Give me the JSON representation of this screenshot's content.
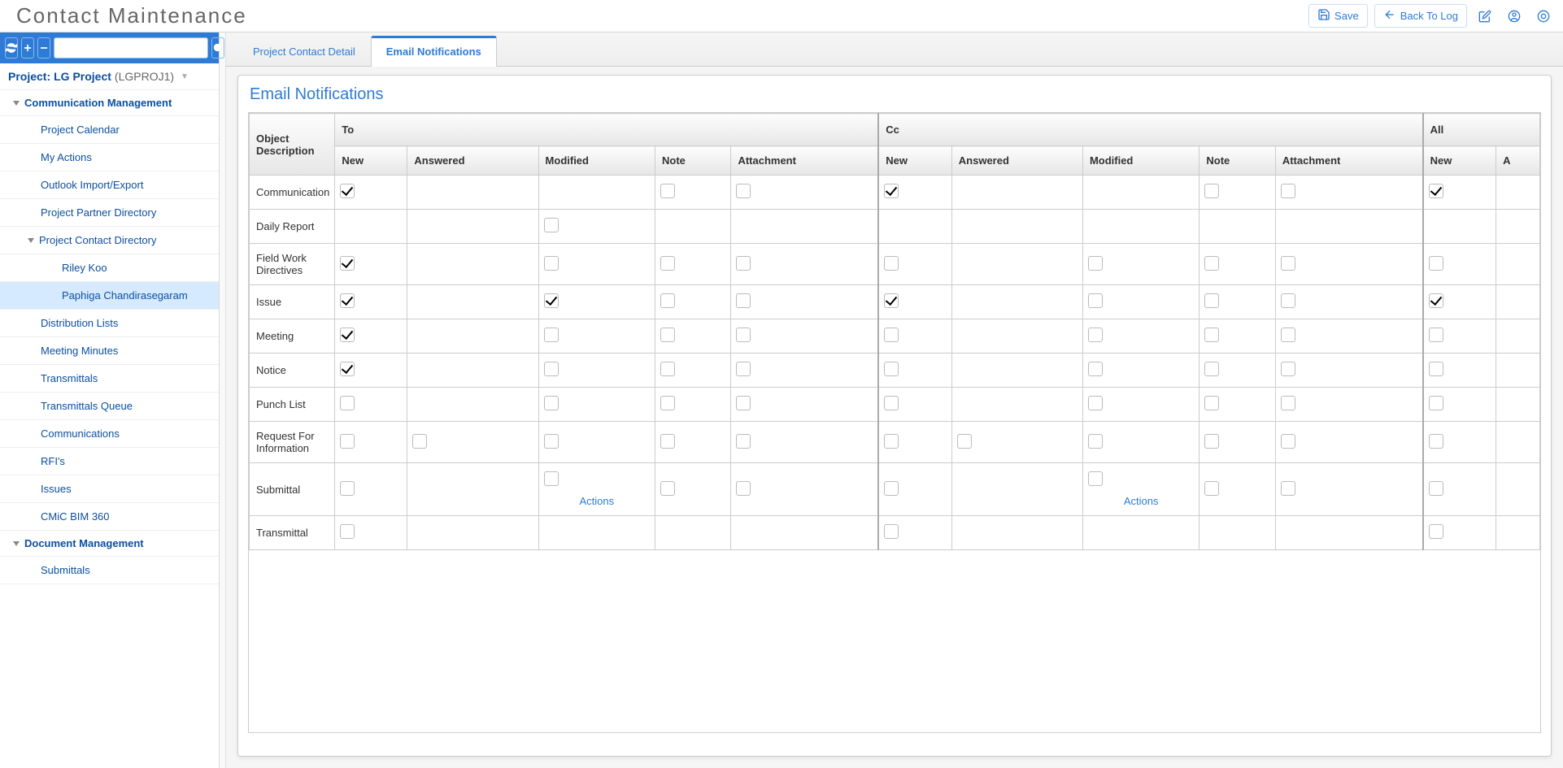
{
  "header": {
    "title": "Contact Maintenance",
    "save_label": "Save",
    "back_label": "Back To Log"
  },
  "sidebar": {
    "search_placeholder": "",
    "project_prefix": "Project:",
    "project_name": "LG Project",
    "project_code": "(LGPROJ1)",
    "groups": [
      {
        "label": "Communication Management",
        "items": [
          {
            "label": "Project Calendar"
          },
          {
            "label": "My Actions"
          },
          {
            "label": "Outlook Import/Export"
          },
          {
            "label": "Project Partner Directory"
          },
          {
            "label": "Project Contact Directory",
            "has_children": true,
            "children": [
              {
                "label": "Riley Koo"
              },
              {
                "label": "Paphiga Chandirasegaram",
                "selected": true
              }
            ]
          },
          {
            "label": "Distribution Lists"
          },
          {
            "label": "Meeting Minutes"
          },
          {
            "label": "Transmittals"
          },
          {
            "label": "Transmittals Queue"
          },
          {
            "label": "Communications"
          },
          {
            "label": "RFI's"
          },
          {
            "label": "Issues"
          },
          {
            "label": "CMiC BIM 360"
          }
        ]
      },
      {
        "label": "Document Management",
        "items": [
          {
            "label": "Submittals"
          }
        ]
      }
    ]
  },
  "tabs": [
    {
      "label": "Project Contact Detail",
      "active": false
    },
    {
      "label": "Email Notifications",
      "active": true
    }
  ],
  "panel": {
    "title": "Email Notifications",
    "actions_label": "Actions",
    "row_header": "Object Description",
    "col_groups": [
      "To",
      "Cc",
      "All"
    ],
    "sub_cols": [
      "New",
      "Answered",
      "Modified",
      "Note",
      "Attachment"
    ],
    "all_sub_cols_visible": [
      "New",
      "Answered"
    ],
    "chart_data": {
      "type": "table",
      "columns": [
        "Object Description",
        "To.New",
        "To.Answered",
        "To.Modified",
        "To.Note",
        "To.Attachment",
        "Cc.New",
        "Cc.Answered",
        "Cc.Modified",
        "Cc.Note",
        "Cc.Attachment",
        "All.New"
      ],
      "rows": [
        {
          "label": "Communication",
          "cells": [
            {
              "present": true,
              "checked": true
            },
            {
              "present": false
            },
            {
              "present": false
            },
            {
              "present": true,
              "checked": false
            },
            {
              "present": true,
              "checked": false
            },
            {
              "present": true,
              "checked": true
            },
            {
              "present": false
            },
            {
              "present": false
            },
            {
              "present": true,
              "checked": false
            },
            {
              "present": true,
              "checked": false
            },
            {
              "present": true,
              "checked": true
            }
          ]
        },
        {
          "label": "Daily Report",
          "cells": [
            {
              "present": false
            },
            {
              "present": false
            },
            {
              "present": true,
              "checked": false
            },
            {
              "present": false
            },
            {
              "present": false
            },
            {
              "present": false
            },
            {
              "present": false
            },
            {
              "present": false
            },
            {
              "present": false
            },
            {
              "present": false
            },
            {
              "present": false
            }
          ]
        },
        {
          "label": "Field Work Directives",
          "cells": [
            {
              "present": true,
              "checked": true
            },
            {
              "present": false
            },
            {
              "present": true,
              "checked": false
            },
            {
              "present": true,
              "checked": false
            },
            {
              "present": true,
              "checked": false
            },
            {
              "present": true,
              "checked": false
            },
            {
              "present": false
            },
            {
              "present": true,
              "checked": false
            },
            {
              "present": true,
              "checked": false
            },
            {
              "present": true,
              "checked": false
            },
            {
              "present": true,
              "checked": false
            }
          ]
        },
        {
          "label": "Issue",
          "cells": [
            {
              "present": true,
              "checked": true
            },
            {
              "present": false
            },
            {
              "present": true,
              "checked": true
            },
            {
              "present": true,
              "checked": false
            },
            {
              "present": true,
              "checked": false
            },
            {
              "present": true,
              "checked": true
            },
            {
              "present": false
            },
            {
              "present": true,
              "checked": false
            },
            {
              "present": true,
              "checked": false
            },
            {
              "present": true,
              "checked": false
            },
            {
              "present": true,
              "checked": true
            }
          ]
        },
        {
          "label": "Meeting",
          "cells": [
            {
              "present": true,
              "checked": true
            },
            {
              "present": false
            },
            {
              "present": true,
              "checked": false
            },
            {
              "present": true,
              "checked": false
            },
            {
              "present": true,
              "checked": false
            },
            {
              "present": true,
              "checked": false
            },
            {
              "present": false
            },
            {
              "present": true,
              "checked": false
            },
            {
              "present": true,
              "checked": false
            },
            {
              "present": true,
              "checked": false
            },
            {
              "present": true,
              "checked": false
            }
          ]
        },
        {
          "label": "Notice",
          "cells": [
            {
              "present": true,
              "checked": true
            },
            {
              "present": false
            },
            {
              "present": true,
              "checked": false
            },
            {
              "present": true,
              "checked": false
            },
            {
              "present": true,
              "checked": false
            },
            {
              "present": true,
              "checked": false
            },
            {
              "present": false
            },
            {
              "present": true,
              "checked": false
            },
            {
              "present": true,
              "checked": false
            },
            {
              "present": true,
              "checked": false
            },
            {
              "present": true,
              "checked": false
            }
          ]
        },
        {
          "label": "Punch List",
          "cells": [
            {
              "present": true,
              "checked": false
            },
            {
              "present": false
            },
            {
              "present": true,
              "checked": false
            },
            {
              "present": true,
              "checked": false
            },
            {
              "present": true,
              "checked": false
            },
            {
              "present": true,
              "checked": false
            },
            {
              "present": false
            },
            {
              "present": true,
              "checked": false
            },
            {
              "present": true,
              "checked": false
            },
            {
              "present": true,
              "checked": false
            },
            {
              "present": true,
              "checked": false
            }
          ]
        },
        {
          "label": "Request For Information",
          "cells": [
            {
              "present": true,
              "checked": false
            },
            {
              "present": true,
              "checked": false
            },
            {
              "present": true,
              "checked": false
            },
            {
              "present": true,
              "checked": false
            },
            {
              "present": true,
              "checked": false
            },
            {
              "present": true,
              "checked": false
            },
            {
              "present": true,
              "checked": false
            },
            {
              "present": true,
              "checked": false
            },
            {
              "present": true,
              "checked": false
            },
            {
              "present": true,
              "checked": false
            },
            {
              "present": true,
              "checked": false
            }
          ]
        },
        {
          "label": "Submittal",
          "actions": true,
          "cells": [
            {
              "present": true,
              "checked": false
            },
            {
              "present": false
            },
            {
              "present": true,
              "checked": false,
              "actions": true
            },
            {
              "present": true,
              "checked": false
            },
            {
              "present": true,
              "checked": false
            },
            {
              "present": true,
              "checked": false
            },
            {
              "present": false
            },
            {
              "present": true,
              "checked": false,
              "actions": true
            },
            {
              "present": true,
              "checked": false
            },
            {
              "present": true,
              "checked": false
            },
            {
              "present": true,
              "checked": false
            }
          ]
        },
        {
          "label": "Transmittal",
          "cells": [
            {
              "present": true,
              "checked": false
            },
            {
              "present": false
            },
            {
              "present": false
            },
            {
              "present": false
            },
            {
              "present": false
            },
            {
              "present": true,
              "checked": false
            },
            {
              "present": false
            },
            {
              "present": false
            },
            {
              "present": false
            },
            {
              "present": false
            },
            {
              "present": true,
              "checked": false
            }
          ]
        }
      ]
    }
  }
}
